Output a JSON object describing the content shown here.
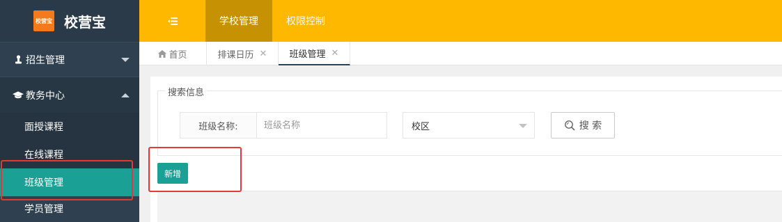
{
  "brand": {
    "logo_text": "校营宝",
    "name": "校营宝"
  },
  "sidebar": {
    "groups": [
      {
        "label": "招生管理",
        "icon": "person-icon",
        "expanded": false
      },
      {
        "label": "教务中心",
        "icon": "graduation-cap-icon",
        "expanded": true,
        "items": [
          "面授课程",
          "在线课程",
          "班级管理"
        ]
      },
      {
        "label": "学员管理",
        "expanded": false
      }
    ],
    "active_item": "班级管理"
  },
  "topbar": {
    "toggle_icon": "menu-collapse-icon",
    "tabs": [
      {
        "label": "学校管理",
        "active": true
      },
      {
        "label": "权限控制",
        "active": false
      }
    ]
  },
  "page_tabs": [
    {
      "label": "首页",
      "icon": "home-icon",
      "closable": false
    },
    {
      "label": "排课日历",
      "closable": true
    },
    {
      "label": "班级管理",
      "closable": true,
      "active": true
    }
  ],
  "search": {
    "legend": "搜索信息",
    "class_name_label": "班级名称:",
    "class_name_placeholder": "班级名称",
    "campus_select": "校区",
    "search_button": "搜 索"
  },
  "actions": {
    "add_button": "新增"
  },
  "colors": {
    "sidebar": "#2f4050",
    "topbar": "#ffb800",
    "accent": "#1aa094",
    "annotation": "#e53935"
  }
}
